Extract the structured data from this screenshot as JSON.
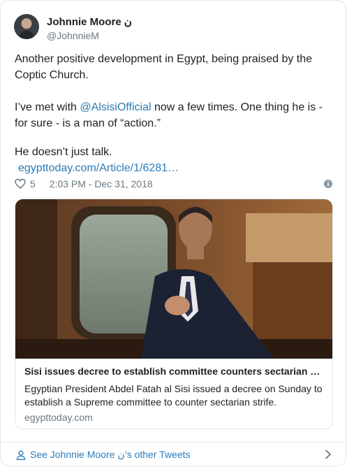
{
  "author": {
    "name": "Johnnie Moore",
    "name_suffix": "ن",
    "handle": "@JohnnieM"
  },
  "tweet": {
    "line1": "Another positive development in Egypt, being praised by the",
    "line2": "Coptic Church.",
    "line3_prefix": "I’ve met with ",
    "line3_mention": "@AlsisiOfficial",
    "line3_suffix": " now a few times. One thing he is -",
    "line4": "for sure - is a man of “action.”",
    "line5": "He doesn’t just talk.",
    "link": "egypttoday.com/Article/1/6281…"
  },
  "meta": {
    "like_count": "5",
    "timestamp": "2:03 PM - Dec 31, 2018"
  },
  "card": {
    "title": "Sisi issues decree to establish committee counters sectarian …",
    "description": "Egyptian President Abdel Fatah al Sisi issued a decree on Sunday to establish a Supreme committee to counter sectarian strife.",
    "domain": "egypttoday.com"
  },
  "footer": {
    "prefix": "See Johnnie Moore ",
    "suffix": "’s other Tweets",
    "name_suffix": "ن"
  },
  "colors": {
    "link": "#2b7bb9",
    "muted": "#697882",
    "border": "#e1e8ed"
  },
  "icons": [
    "heart-icon",
    "info-icon",
    "person-icon",
    "chevron-right-icon"
  ]
}
